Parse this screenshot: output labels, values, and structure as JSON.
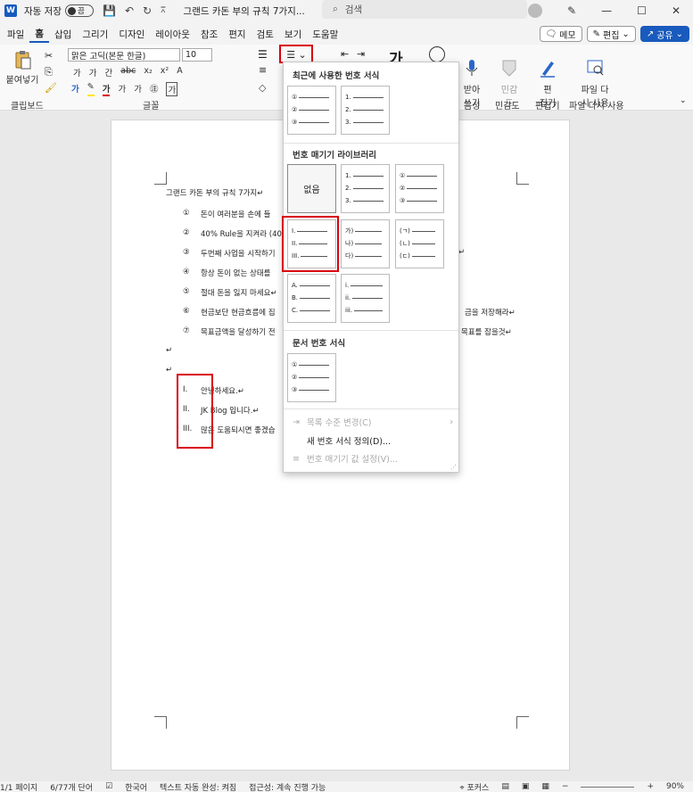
{
  "titlebar": {
    "app_logo": "W",
    "autosave_label": "자동 저장",
    "autosave_state": "끔",
    "doc_title": "그랜드 카돈 부의 규칙 7가지...",
    "search_placeholder": "검색"
  },
  "menu": {
    "tabs": [
      "파일",
      "홈",
      "삽입",
      "그리기",
      "디자인",
      "레이아웃",
      "참조",
      "편지",
      "검토",
      "보기",
      "도움말"
    ],
    "active": "홈",
    "memo": "메모",
    "edit": "편집",
    "share": "공유"
  },
  "ribbon": {
    "paste": "붙여넣기",
    "clipboard": "클립보드",
    "font_name": "맑은 고딕(본문 한글)",
    "font_size": "10",
    "font_group": "글꼴",
    "voice": "받아\n쓰기",
    "voice_group": "음성",
    "sensitivity": "민감\n도",
    "sensitivity_group": "민감도",
    "editor": "편\n집기",
    "editor_group": "편집기",
    "reuse": "파일 다\n시 사용",
    "reuse_group": "파일 다시 사용",
    "style_glyph": "가"
  },
  "document": {
    "title": "그랜드 카돈 부의 규칙 7가지↵",
    "numbered": [
      {
        "num": "①",
        "text": "돈이 여러분을 손에 들"
      },
      {
        "num": "②",
        "text": "40% Rule을 지켜라 (40"
      },
      {
        "num": "③",
        "text": "두번째 사업을 시작하기"
      },
      {
        "num": "④",
        "text": "항상 돈이 없는 상태를"
      },
      {
        "num": "⑤",
        "text": "절대 돈을 잃지 마세요↵"
      },
      {
        "num": "⑥",
        "text": "현금보단 현금흐름에 집"
      },
      {
        "num": "⑦",
        "text": "목표금액을 달성하기 전"
      }
    ],
    "numbered_tail": {
      "six": "금을 저장해라↵",
      "seven": "목표를 잡을것↵",
      "three": "↵"
    },
    "roman": [
      {
        "num": "I.",
        "text": "안녕하세요.↵"
      },
      {
        "num": "II.",
        "text": "JK Blog 입니다.↵"
      },
      {
        "num": "III.",
        "text": "많은 도움되시면 좋겠습"
      }
    ],
    "para_marks": [
      "↵",
      "↵"
    ]
  },
  "dropdown": {
    "recent_header": "최근에 사용한 번호 서식",
    "library_header": "번호 매기기 라이브러리",
    "doc_header": "문서 번호 서식",
    "none_label": "없음",
    "formats": {
      "circled": [
        "①",
        "②",
        "③"
      ],
      "arabic": [
        "1.",
        "2.",
        "3."
      ],
      "roman_upper": [
        "I.",
        "II.",
        "III."
      ],
      "hangul": [
        "가)",
        "나)",
        "다)"
      ],
      "jamo": [
        "(ㄱ)",
        "(ㄴ)",
        "(ㄷ)"
      ],
      "alpha_upper": [
        "A.",
        "B.",
        "C."
      ],
      "roman_lower": [
        "i.",
        "ii.",
        "iii."
      ]
    },
    "cmd_change_level": "목록 수준 변경(C)",
    "cmd_define_new": "새 번호 서식 정의(D)...",
    "cmd_set_value": "번호 매기기 값 설정(V)..."
  },
  "status": {
    "page": "1/1 페이지",
    "words": "6/77개 단어",
    "language": "한국어",
    "autocomplete": "텍스트 자동 완성: 켜짐",
    "accessibility": "접근성: 계속 진행 가능",
    "focus": "포커스",
    "zoom": "90%"
  },
  "colors": {
    "accent": "#185abd",
    "callout": "#d9000f"
  }
}
